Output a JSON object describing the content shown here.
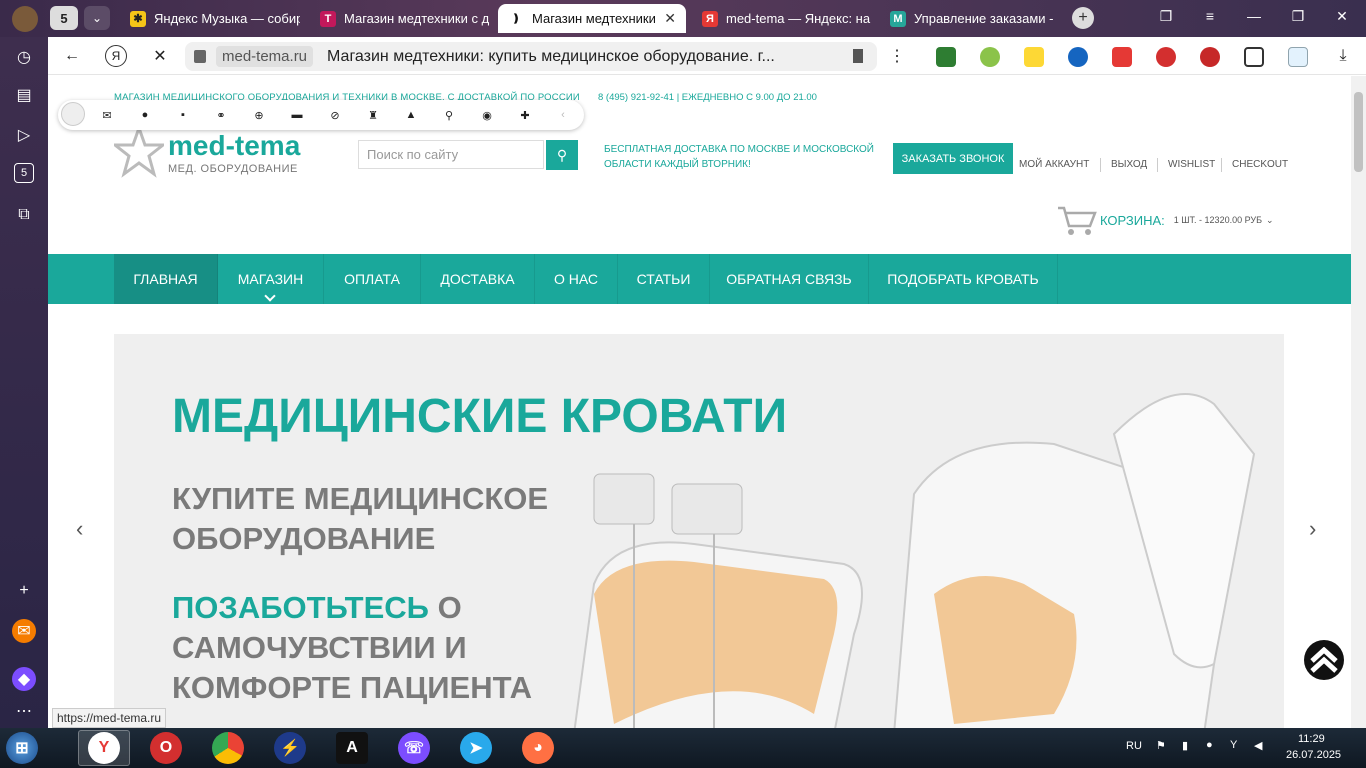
{
  "browser": {
    "tab_count_badge": "5",
    "tabs": [
      {
        "label": "Яндекс Музыка — собир",
        "color": "#f5c518"
      },
      {
        "label": "Магазин медтехники с д",
        "color": "#c2185b"
      },
      {
        "label": "Магазин медтехники",
        "color": "#111111"
      },
      {
        "label": "med-tema — Яндекс: на",
        "color": "#e53935"
      },
      {
        "label": "Управление заказами -",
        "color": "#26a69a"
      }
    ],
    "address": {
      "domain": "med-tema.ru",
      "title": "Магазин медтехники: купить медицинское оборудование. г..."
    },
    "status_url": "https://med-tema.ru"
  },
  "site": {
    "topline": "МАГАЗИН МЕДИЦИНСКОГО ОБОРУДОВАНИЯ И ТЕХНИКИ В МОСКВЕ. С ДОСТАВКОЙ ПО РОССИИ",
    "contact": "8 (495) 921-92-41 | ЕЖЕДНЕВНО С 9.00 ДО 21.00",
    "logo": {
      "name": "med-tema",
      "sub": "МЕД. ОБОРУДОВАНИЕ"
    },
    "search_placeholder": "Поиск по сайту",
    "promo": "БЕСПЛАТНАЯ ДОСТАВКА ПО МОСКВЕ И МОСКОВСКОЙ ОБЛАСТИ КАЖДЫЙ ВТОРНИК!",
    "call_button": "ЗАКАЗАТЬ ЗВОНОК",
    "account_links": [
      "МОЙ АККАУНТ",
      "ВЫХОД",
      "WISHLIST",
      "CHECKOUT"
    ],
    "cart": {
      "label": "КОРЗИНА:",
      "value": "1 ШТ. - 12320.00 РУБ"
    },
    "nav": [
      "ГЛАВНАЯ",
      "МАГАЗИН",
      "ОПЛАТА",
      "ДОСТАВКА",
      "О НАС",
      "СТАТЬИ",
      "ОБРАТНАЯ СВЯЗЬ",
      "ПОДОБРАТЬ КРОВАТЬ"
    ],
    "hero": {
      "title": "МЕДИЦИНСКИЕ КРОВАТИ",
      "subtitle": "КУПИТЕ МЕДИЦИНСКОЕ ОБОРУДОВАНИЕ",
      "tagline_highlight": "ПОЗАБОТЬТЕСЬ",
      "tagline_rest": "О САМОЧУВСТВИИ И КОМФОРТЕ ПАЦИЕНТА"
    },
    "accent_color": "#1aa89b"
  },
  "taskbar": {
    "language": "RU",
    "time": "11:29",
    "date": "26.07.2025"
  }
}
